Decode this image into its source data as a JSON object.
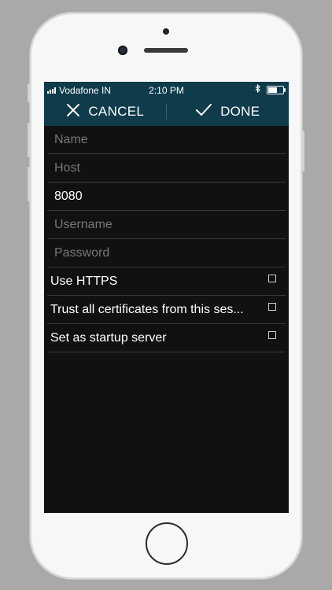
{
  "status_bar": {
    "carrier": "Vodafone IN",
    "time": "2:10 PM",
    "bluetooth_icon": "bluetooth-icon",
    "battery_icon": "battery-icon",
    "battery_level": 0.6
  },
  "toolbar": {
    "cancel_label": "CANCEL",
    "done_label": "DONE",
    "cancel_icon": "close-icon",
    "done_icon": "checkmark-icon"
  },
  "form": {
    "name": {
      "value": "",
      "placeholder": "Name"
    },
    "host": {
      "value": "",
      "placeholder": "Host"
    },
    "port": {
      "value": "8080",
      "placeholder": ""
    },
    "username": {
      "value": "",
      "placeholder": "Username"
    },
    "password": {
      "value": "",
      "placeholder": "Password"
    }
  },
  "options": [
    {
      "label": "Use HTTPS",
      "checked": false
    },
    {
      "label": "Trust all certificates from this ses...",
      "checked": false
    },
    {
      "label": "Set as startup server",
      "checked": false
    }
  ],
  "colors": {
    "toolbar_bg": "#0f3b4b",
    "screen_bg": "#111111",
    "divider": "#3a3a3a",
    "placeholder": "#777777"
  }
}
